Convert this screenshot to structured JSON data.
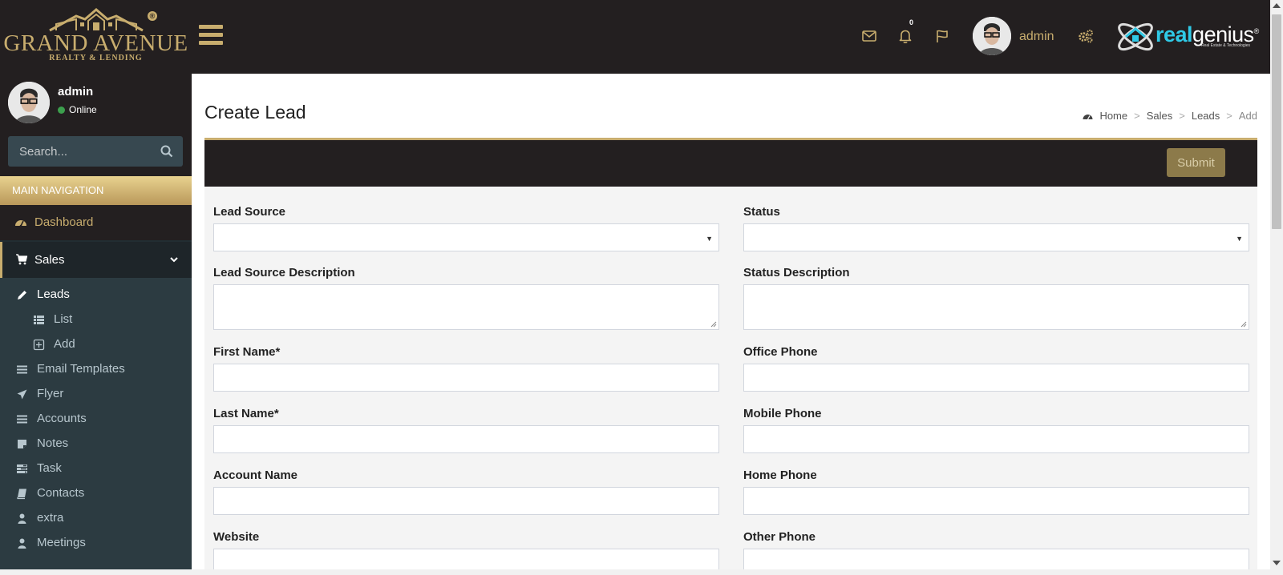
{
  "header": {
    "logo": {
      "main": "GRAND AVENUE",
      "sub": "REALTY & LENDING",
      "reg": "®"
    },
    "notification_count": "0",
    "user_name": "admin",
    "partner_logo": {
      "real": "real",
      "genius": "genius",
      "reg": "®",
      "tagline": "Real Estate & Technologies"
    },
    "icons": {
      "menu": "hamburger-icon",
      "mail": "mail-icon",
      "bell": "bell-icon",
      "flag": "flag-icon",
      "settings": "gears-icon"
    }
  },
  "sidebar": {
    "user": {
      "name": "admin",
      "status": "Online"
    },
    "search": {
      "placeholder": "Search..."
    },
    "nav_header": "MAIN NAVIGATION",
    "dashboard": "Dashboard",
    "sales": "Sales",
    "submenu": [
      {
        "label": "Leads",
        "icon": "pencil-icon"
      },
      {
        "label": "List",
        "icon": "list-icon"
      },
      {
        "label": "Add",
        "icon": "plus-square-icon"
      },
      {
        "label": "Email Templates",
        "icon": "bars-icon"
      },
      {
        "label": "Flyer",
        "icon": "plane-icon"
      },
      {
        "label": "Accounts",
        "icon": "bars-icon"
      },
      {
        "label": "Notes",
        "icon": "sticky-note-icon"
      },
      {
        "label": "Task",
        "icon": "tasks-icon"
      },
      {
        "label": "Contacts",
        "icon": "book-icon"
      },
      {
        "label": "extra",
        "icon": "user-icon"
      },
      {
        "label": "Meetings",
        "icon": "user-icon"
      }
    ]
  },
  "page": {
    "title": "Create Lead",
    "breadcrumb": [
      "Home",
      "Sales",
      "Leads",
      "Add"
    ],
    "submit_label": "Submit"
  },
  "form": {
    "left": [
      {
        "label": "Lead Source",
        "type": "select",
        "value": ""
      },
      {
        "label": "Lead Source Description",
        "type": "textarea",
        "value": ""
      },
      {
        "label": "First Name*",
        "type": "text",
        "value": ""
      },
      {
        "label": "Last Name*",
        "type": "text",
        "value": ""
      },
      {
        "label": "Account Name",
        "type": "text",
        "value": ""
      },
      {
        "label": "Website",
        "type": "text",
        "value": ""
      }
    ],
    "right": [
      {
        "label": "Status",
        "type": "select",
        "value": ""
      },
      {
        "label": "Status Description",
        "type": "textarea",
        "value": ""
      },
      {
        "label": "Office Phone",
        "type": "text",
        "value": ""
      },
      {
        "label": "Mobile Phone",
        "type": "text",
        "value": ""
      },
      {
        "label": "Home Phone",
        "type": "text",
        "value": ""
      },
      {
        "label": "Other Phone",
        "type": "text",
        "value": ""
      }
    ]
  },
  "colors": {
    "header_bg": "#231f20",
    "gold": "#c8ad6e",
    "sidebar_bg": "#222d32",
    "submenu_bg": "#2c3b41",
    "accent_cyan": "#2fc9e6",
    "online": "#3c9f4d"
  }
}
